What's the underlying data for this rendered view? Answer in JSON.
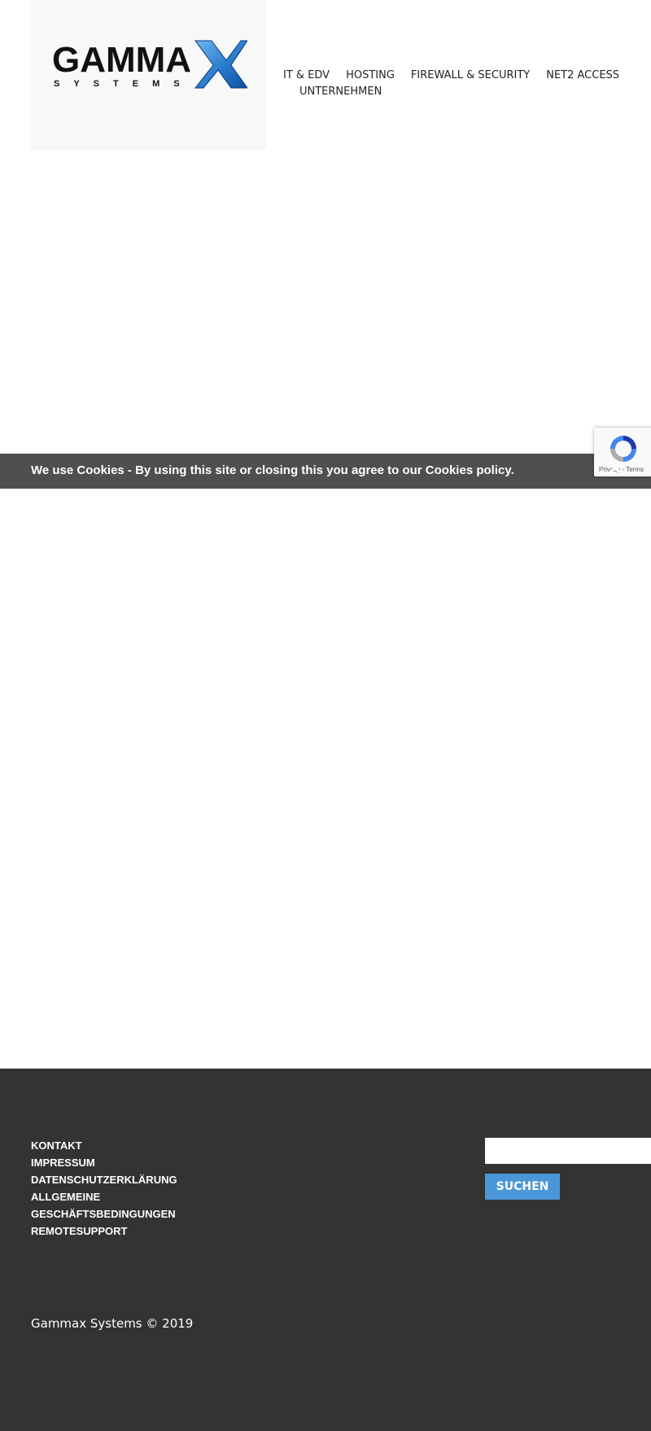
{
  "logo": {
    "wordmark": "GAMMA",
    "mark": "X",
    "tagline": "SYSTEMS"
  },
  "nav": {
    "items": [
      {
        "label": "IT & EDV"
      },
      {
        "label": "HOSTING"
      },
      {
        "label": "FIREWALL & SECURITY"
      },
      {
        "label": "NET2 ACCESS"
      },
      {
        "label": "UNTERNEHMEN"
      }
    ]
  },
  "cookie": {
    "text": "We use Cookies - By using this site or closing this you agree to our Cookies policy.",
    "close_icon": "close-icon"
  },
  "recaptcha": {
    "links": "Privacy - Terms"
  },
  "footer": {
    "links": [
      {
        "label": "KONTAKT"
      },
      {
        "label": "IMPRESSUM"
      },
      {
        "label": "DATENSCHUTZERKLÄRUNG"
      },
      {
        "label": "ALLGEMEINE GESCHÄFTSBEDINGUNGEN"
      },
      {
        "label": "REMOTESUPPORT"
      }
    ],
    "search": {
      "value": "",
      "button_label": "SUCHEN"
    },
    "copyright": "Gammax Systems © 2019"
  },
  "colors": {
    "footer_bg": "#333333",
    "cookie_bg": "#4f4f4f",
    "search_button": "#4a97d8",
    "logo_blue": "#2f7fd0"
  }
}
